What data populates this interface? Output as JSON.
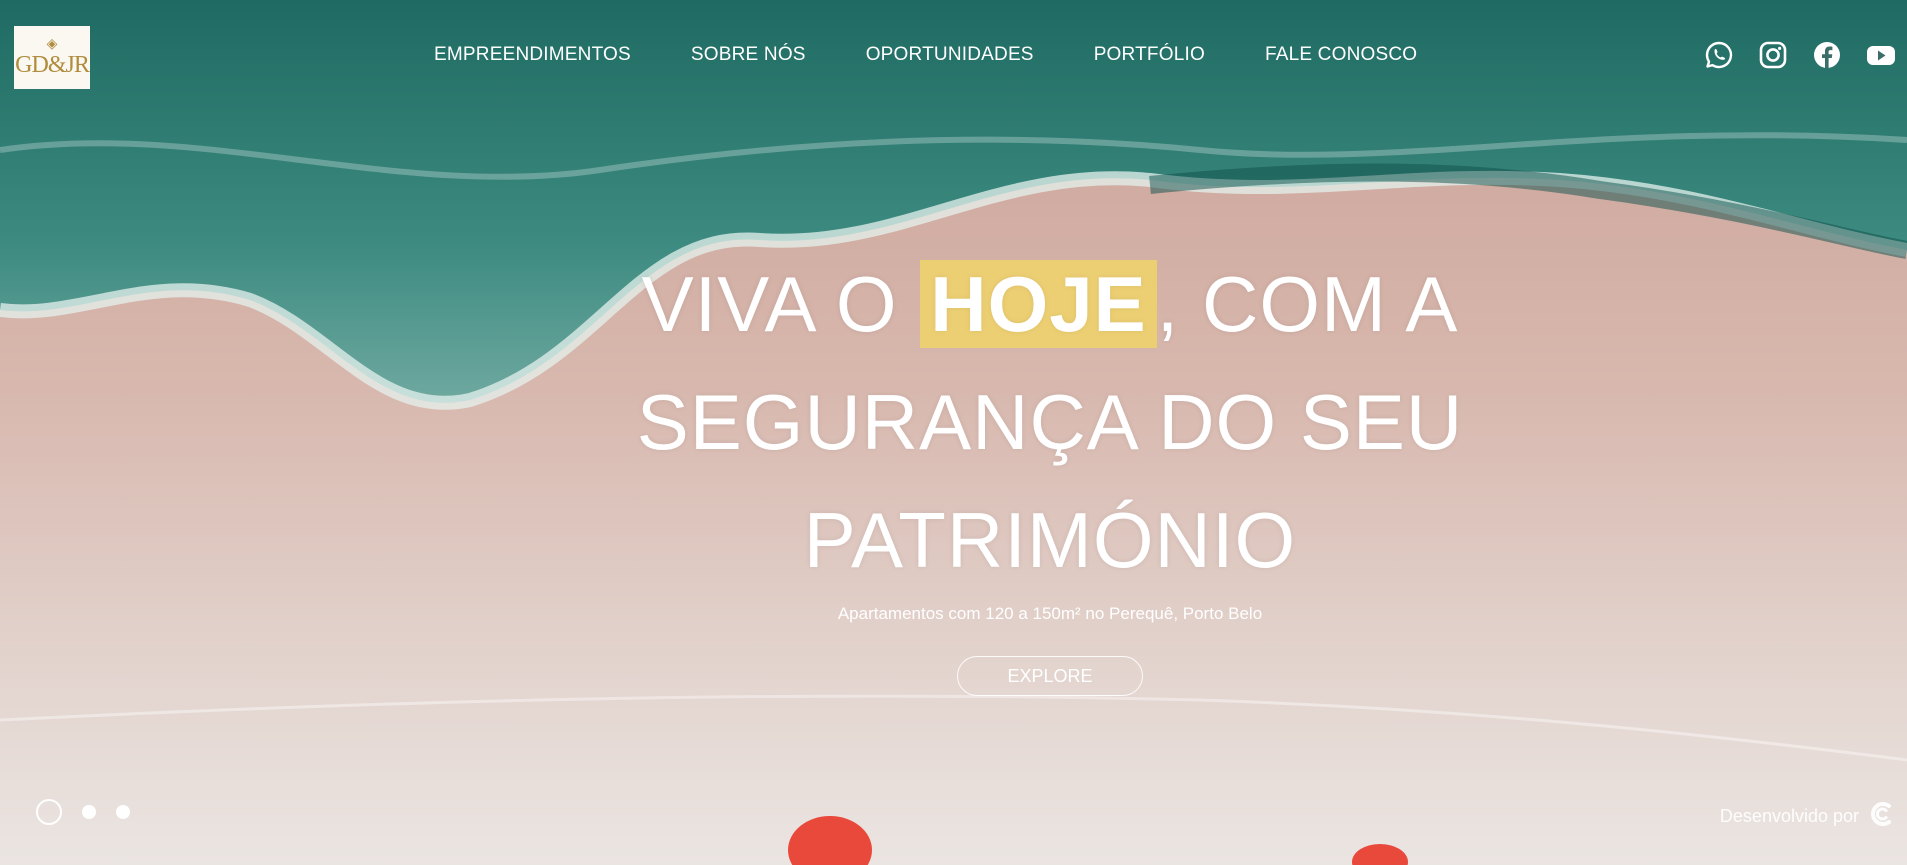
{
  "brand": {
    "logo_text": "GD&JR",
    "logo_mark": "◈"
  },
  "nav": {
    "items": [
      {
        "label": "EMPREENDIMENTOS"
      },
      {
        "label": "SOBRE NÓS"
      },
      {
        "label": "OPORTUNIDADES"
      },
      {
        "label": "PORTFÓLIO"
      },
      {
        "label": "FALE CONOSCO"
      }
    ]
  },
  "social": [
    {
      "icon": "whatsapp-icon"
    },
    {
      "icon": "instagram-icon"
    },
    {
      "icon": "facebook-icon"
    },
    {
      "icon": "youtube-icon"
    }
  ],
  "hero": {
    "line1_pre": "VIVA O ",
    "line1_highlight": "HOJE",
    "line1_post": ", COM A",
    "line2": "SEGURANÇA DO SEU",
    "line3": "PATRIMÓNIO",
    "subtitle": "Apartamentos com 120 a 150m² no Perequê, Porto Belo",
    "cta_label": "EXPLORE",
    "highlight_color": "#edcf73"
  },
  "carousel": {
    "count": 3,
    "active_index": 0
  },
  "footer": {
    "credit_text": "Desenvolvido por"
  }
}
